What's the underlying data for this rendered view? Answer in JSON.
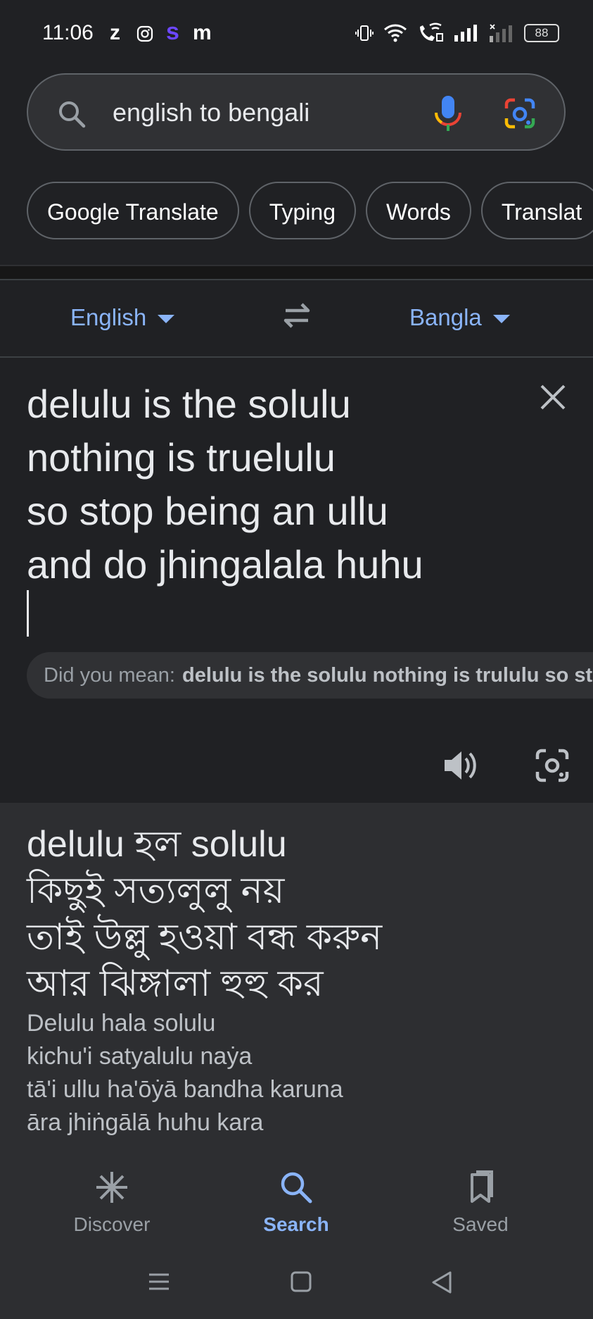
{
  "status_bar": {
    "time": "11:06",
    "apps": [
      "z",
      "instagram-icon",
      "s",
      "m"
    ],
    "battery": "88"
  },
  "search": {
    "query": "english to bengali"
  },
  "chips": [
    "Google Translate",
    "Typing",
    "Words",
    "Translat"
  ],
  "translate": {
    "source_lang": "English",
    "target_lang": "Bangla",
    "source_text": "delulu is the solulu\nnothing is truelulu\nso stop being an ullu\nand do jhingalala huhu",
    "did_you_mean_label": "Did you mean:",
    "did_you_mean_text": "delulu is the solulu nothing is trululu so stop",
    "translation": "delulu হল solulu\nকিছুই সত্যলুলু নয়\nতাই উল্লু হওয়া বন্ধ করুন\nআর ঝিঙ্গালা হুহু কর",
    "transliteration": "Delulu hala solulu\nkichu'i satyalulu naẏa\ntā'i ullu ha'ōẏā bandha karuna\nāra jhiṅgālā huhu kara"
  },
  "bottom_nav": {
    "discover": "Discover",
    "search": "Search",
    "saved": "Saved",
    "active": "search"
  },
  "colors": {
    "accent": "#8ab4f8",
    "background": "#202124",
    "panel": "#2d2e31"
  }
}
